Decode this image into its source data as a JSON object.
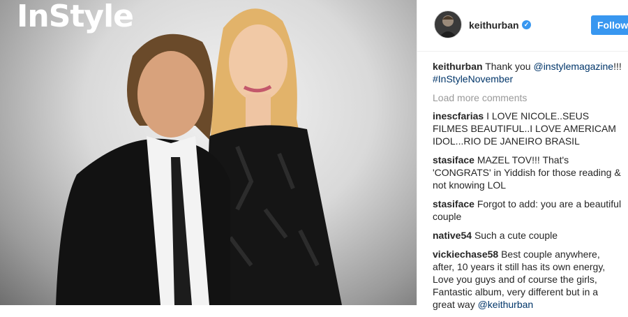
{
  "photo": {
    "brand_text": "InStyle"
  },
  "post": {
    "username": "keithurban",
    "verified_icon": "verified-badge-icon",
    "follow_label": "Follow",
    "accent_color": "#3897f0"
  },
  "caption": {
    "user": "keithurban",
    "text": "Thank you ",
    "mention": "@instylemagazine",
    "after": "!!!",
    "hashtag": "#InStyleNovember"
  },
  "load_more": "Load more comments",
  "comments": [
    {
      "user": "inescfarias",
      "text": "I LOVE NICOLE..SEUS FILMES BEAUTIFUL..I LOVE AMERICAM IDOL...RIO DE JANEIRO BRASIL"
    },
    {
      "user": "stasiface",
      "text": "MAZEL TOV!!! That's 'CONGRATS' in Yiddish for those reading & not knowing LOL"
    },
    {
      "user": "stasiface",
      "text": "Forgot to add: you are a beautiful couple"
    },
    {
      "user": "native54",
      "text": "Such a cute couple"
    },
    {
      "user": "vickiechase58",
      "text": "Best couple anywhere, after, 10 years it still has its own energy, Love you guys and of course the girls, Fantastic album, very different but in a great way ",
      "mention": "@keithurban"
    }
  ]
}
